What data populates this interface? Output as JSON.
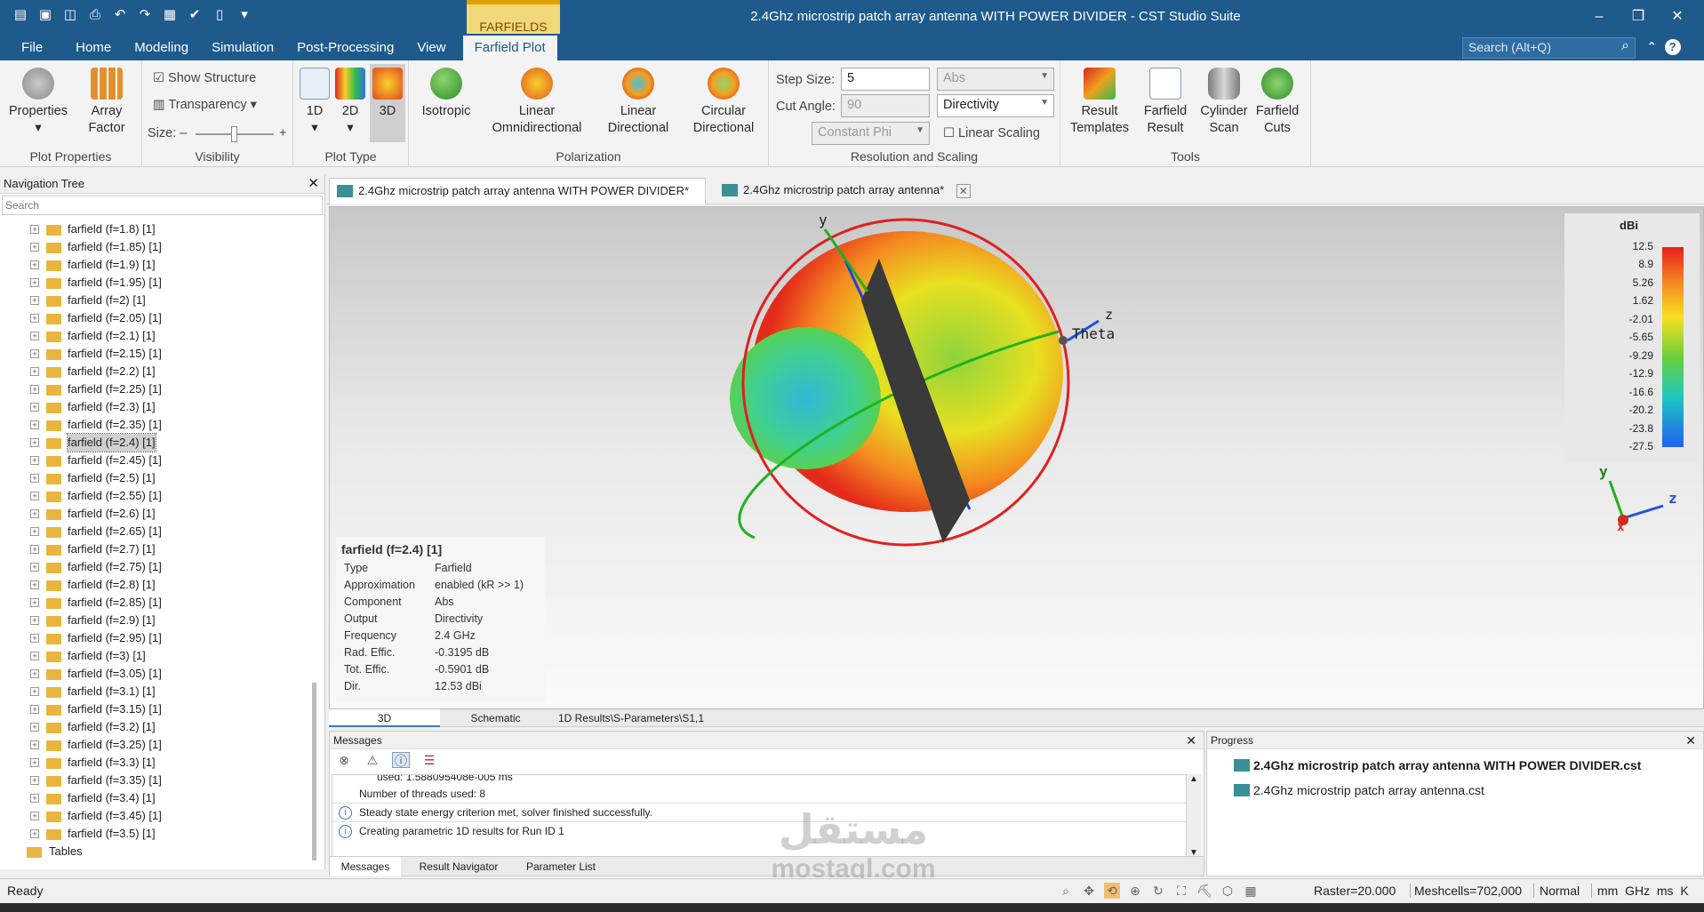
{
  "window": {
    "title": "2.4Ghz microstrip patch array antenna WITH POWER DIVIDER - CST Studio Suite",
    "context_tab_header": "FARFIELDS",
    "search_placeholder": "Search (Alt+Q)",
    "help_label": "?"
  },
  "tabs": [
    "File",
    "Home",
    "Modeling",
    "Simulation",
    "Post-Processing",
    "View",
    "Farfield Plot"
  ],
  "ribbon": {
    "properties": "Properties",
    "array_factor_1": "Array",
    "array_factor_2": "Factor",
    "group_plot_properties": "Plot Properties",
    "show_structure": "Show Structure",
    "transparency": "Transparency",
    "size": "Size:",
    "group_visibility": "Visibility",
    "plot_1d": "1D",
    "plot_2d": "2D",
    "plot_3d": "3D",
    "group_plot_type": "Plot Type",
    "isotropic": "Isotropic",
    "linear_omni_1": "Linear",
    "linear_omni_2": "Omnidirectional",
    "linear_dir_1": "Linear",
    "linear_dir_2": "Directional",
    "circular_dir_1": "Circular",
    "circular_dir_2": "Directional",
    "group_polarization": "Polarization",
    "step_size_label": "Step Size:",
    "step_size_value": "5",
    "cut_angle_label": "Cut Angle:",
    "cut_angle_value": "90",
    "constant_phi": "Constant Phi",
    "abs_select": "Abs",
    "directivity_select": "Directivity",
    "linear_scaling": "Linear Scaling",
    "group_resolution": "Resolution and Scaling",
    "result_templates_1": "Result",
    "result_templates_2": "Templates",
    "farfield_result_1": "Farfield",
    "farfield_result_2": "Result",
    "cylinder_scan_1": "Cylinder",
    "cylinder_scan_2": "Scan",
    "farfield_cuts_1": "Farfield",
    "farfield_cuts_2": "Cuts",
    "group_tools": "Tools"
  },
  "nav": {
    "title": "Navigation Tree",
    "search_placeholder": "Search",
    "items": [
      "farfield (f=1.8) [1]",
      "farfield (f=1.85) [1]",
      "farfield (f=1.9) [1]",
      "farfield (f=1.95) [1]",
      "farfield (f=2) [1]",
      "farfield (f=2.05) [1]",
      "farfield (f=2.1) [1]",
      "farfield (f=2.15) [1]",
      "farfield (f=2.2) [1]",
      "farfield (f=2.25) [1]",
      "farfield (f=2.3) [1]",
      "farfield (f=2.35) [1]",
      "farfield (f=2.4) [1]",
      "farfield (f=2.45) [1]",
      "farfield (f=2.5) [1]",
      "farfield (f=2.55) [1]",
      "farfield (f=2.6) [1]",
      "farfield (f=2.65) [1]",
      "farfield (f=2.7) [1]",
      "farfield (f=2.75) [1]",
      "farfield (f=2.8) [1]",
      "farfield (f=2.85) [1]",
      "farfield (f=2.9) [1]",
      "farfield (f=2.95) [1]",
      "farfield (f=3) [1]",
      "farfield (f=3.05) [1]",
      "farfield (f=3.1) [1]",
      "farfield (f=3.15) [1]",
      "farfield (f=3.2) [1]",
      "farfield (f=3.25) [1]",
      "farfield (f=3.3) [1]",
      "farfield (f=3.35) [1]",
      "farfield (f=3.4) [1]",
      "farfield (f=3.45) [1]",
      "farfield (f=3.5) [1]"
    ],
    "selected_index": 12,
    "tables": "Tables"
  },
  "doc_tabs": [
    "2.4Ghz microstrip patch array antenna WITH POWER DIVIDER*",
    "2.4Ghz microstrip patch array antenna*"
  ],
  "view": {
    "axis_y": "y",
    "axis_z": "z",
    "theta": "Theta",
    "mini_x": "x",
    "mini_y": "y",
    "mini_z": "z"
  },
  "info": {
    "title": "farfield (f=2.4) [1]",
    "rows": [
      {
        "k": "Type",
        "v": "Farfield"
      },
      {
        "k": "Approximation",
        "v": "enabled (kR >> 1)"
      },
      {
        "k": "Component",
        "v": "Abs"
      },
      {
        "k": "Output",
        "v": "Directivity"
      },
      {
        "k": "Frequency",
        "v": "2.4 GHz"
      },
      {
        "k": "Rad. Effic.",
        "v": "-0.3195 dB"
      },
      {
        "k": "Tot. Effic.",
        "v": "-0.5901 dB"
      },
      {
        "k": "Dir.",
        "v": "12.53 dBi"
      }
    ]
  },
  "legend": {
    "unit": "dBi",
    "ticks": [
      "12.5",
      "8.9",
      "5.26",
      "1.62",
      "-2.01",
      "-5.65",
      "-9.29",
      "-12.9",
      "-16.6",
      "-20.2",
      "-23.8",
      "-27.5"
    ]
  },
  "view_tabs": [
    "3D",
    "Schematic",
    "1D Results\\S-Parameters\\S1,1"
  ],
  "messages": {
    "title": "Messages",
    "lines": [
      "used: 1.588095408e-005 ms",
      "Number of threads used: 8",
      "Steady state energy criterion met, solver finished successfully.",
      "Creating parametric 1D results for Run ID 1"
    ],
    "tabs": [
      "Messages",
      "Result Navigator",
      "Parameter List"
    ]
  },
  "progress": {
    "title": "Progress",
    "items": [
      "2.4Ghz microstrip patch array antenna WITH POWER DIVIDER.cst",
      "2.4Ghz microstrip patch array antenna.cst"
    ]
  },
  "status": {
    "ready": "Ready",
    "raster": "Raster=20.000",
    "meshcells": "Meshcells=702,000",
    "mode": "Normal",
    "units": "mm  GHz  ms  K"
  },
  "watermark": {
    "arabic": "مستقل",
    "latin": "mostaql.com"
  }
}
